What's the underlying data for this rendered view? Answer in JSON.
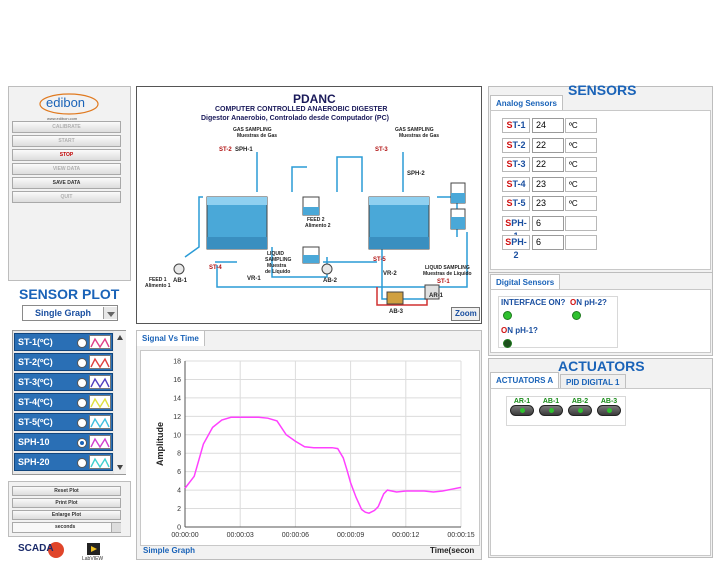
{
  "sidebar": {
    "logo": "edibon",
    "logo_url": "www.edibon.com",
    "buttons": [
      {
        "label": "CALIBRATE",
        "state": "dim"
      },
      {
        "label": "START",
        "state": "dim"
      },
      {
        "label": "STOP",
        "state": "red"
      },
      {
        "label": "VIEW DATA",
        "state": "dim"
      },
      {
        "label": "SAVE DATA",
        "state": "normal"
      },
      {
        "label": "QUIT",
        "state": "dim"
      }
    ]
  },
  "sensor_plot": {
    "title": "SENSOR PLOT",
    "mode": "Single Graph",
    "items": [
      {
        "label": "ST-1(ºC)",
        "selected": false,
        "color": "#e0408a"
      },
      {
        "label": "ST-2(ºC)",
        "selected": false,
        "color": "#e04040"
      },
      {
        "label": "ST-3(ºC)",
        "selected": false,
        "color": "#5040c0"
      },
      {
        "label": "ST-4(ºC)",
        "selected": false,
        "color": "#e0e040"
      },
      {
        "label": "ST-5(ºC)",
        "selected": false,
        "color": "#40c0e0"
      },
      {
        "label": "SPH-10",
        "selected": true,
        "color": "#d040d0"
      },
      {
        "label": "SPH-20",
        "selected": false,
        "color": "#40d0d0"
      }
    ],
    "buttons": [
      "Reset Plot",
      "Print Plot",
      "Enlarge Plot"
    ],
    "units_select": "seconds"
  },
  "footer_logos": {
    "scada": "SCADA",
    "labview": "LabVIEW"
  },
  "diagram": {
    "title": "PDANC",
    "subtitle": "COMPUTER CONTROLLED ANAEROBIC DIGESTER",
    "subtitle_es": "Digestor Anaerobio, Controlado desde Computador (PC)",
    "labels": {
      "gas1": "GAS SAMPLING",
      "gas1_es": "Muestras de Gas",
      "gas2": "GAS SAMPLING",
      "gas2_es": "Muestras de Gas",
      "st2": "ST-2",
      "sph1": "SPH-1",
      "st3": "ST-3",
      "sph2": "SPH-2",
      "st4": "ST-4",
      "st5": "ST-5",
      "st1": "ST-1",
      "feed2": "FEED 2",
      "feed2_es": "Alimento 2",
      "feed1": "FEED 1",
      "feed1_es": "Alimento 1",
      "liq1": "LIQUID",
      "liq1b": "SAMPLING",
      "liq1_es": "Muestra",
      "liq1_es2": "de Líquido",
      "liq2": "LIQUID SAMPLING",
      "liq2_es": "Muestras de Líquido",
      "vr1": "VR-1",
      "vr2": "VR-2",
      "ab1": "AB-1",
      "ab2": "AB-2",
      "ab3": "AB-3",
      "ar1": "AR-1"
    },
    "zoom_label": "Zoom"
  },
  "sensors": {
    "title": "SENSORS",
    "analog_tab": "Analog Sensors",
    "rows": [
      {
        "tag_r": "S",
        "tag": "T-1",
        "value": "24",
        "unit": "ºC"
      },
      {
        "tag_r": "S",
        "tag": "T-2",
        "value": "22",
        "unit": "ºC"
      },
      {
        "tag_r": "S",
        "tag": "T-3",
        "value": "22",
        "unit": "ºC"
      },
      {
        "tag_r": "S",
        "tag": "T-4",
        "value": "23",
        "unit": "ºC"
      },
      {
        "tag_r": "S",
        "tag": "T-5",
        "value": "23",
        "unit": "ºC"
      },
      {
        "tag_r": "S",
        "tag": "PH-1",
        "value": "6",
        "unit": ""
      },
      {
        "tag_r": "S",
        "tag": "PH-2",
        "value": "6",
        "unit": ""
      }
    ],
    "digital_tab": "Digital Sensors",
    "digital": [
      {
        "label": "INTERFACE ON?",
        "on": true
      },
      {
        "label_r": "O",
        "label": "N pH-2?",
        "on": true
      },
      {
        "label_r": "O",
        "label": "N pH-1?",
        "on": false
      }
    ]
  },
  "actuators": {
    "title": "ACTUATORS",
    "tabs": [
      "ACTUATORS A",
      "PID DIGITAL 1"
    ],
    "items": [
      {
        "label": "AR-1"
      },
      {
        "label": "AB-1"
      },
      {
        "label": "AB-2"
      },
      {
        "label": "AB-3"
      }
    ]
  },
  "graph": {
    "tab": "Signal Vs Time",
    "footer": "Simple Graph",
    "time_label": "Time(secon",
    "line_color": "#ff40ff"
  },
  "chart_data": {
    "type": "line",
    "title": "",
    "xlabel": "Time(seconds)",
    "ylabel": "Amplitude",
    "ylim": [
      0,
      18
    ],
    "xlim": [
      0,
      15
    ],
    "x_ticks": [
      "00:00:00",
      "00:00:03",
      "00:00:06",
      "00:00:09",
      "00:00:12",
      "00:00:15"
    ],
    "y_ticks": [
      "0",
      "2",
      "4",
      "6",
      "8",
      "10",
      "12",
      "14",
      "16",
      "18"
    ],
    "grid": true,
    "series": [
      {
        "name": "SPH-10",
        "x": [
          0,
          0.5,
          1,
          1.5,
          2,
          2.5,
          3,
          4,
          4.5,
          5,
          5.5,
          6,
          6.5,
          7,
          7.5,
          8,
          8.3,
          8.6,
          8.8,
          9,
          9.3,
          9.6,
          9.8,
          10,
          10.3,
          10.5,
          10.8,
          11,
          11.5,
          12,
          12.5,
          13,
          13.5,
          14,
          14.5,
          15
        ],
        "y": [
          4.2,
          5.5,
          9,
          10.8,
          11.6,
          11.9,
          11.9,
          11.9,
          11.8,
          11.5,
          10,
          9.3,
          8.7,
          8.6,
          8.6,
          8.6,
          8.5,
          7.5,
          6.2,
          4.8,
          3.2,
          1.9,
          1.6,
          1.5,
          1.8,
          2.2,
          3.6,
          4.0,
          3.8,
          3.9,
          3.9,
          3.9,
          3.8,
          3.9,
          4.1,
          4.3
        ]
      }
    ]
  }
}
